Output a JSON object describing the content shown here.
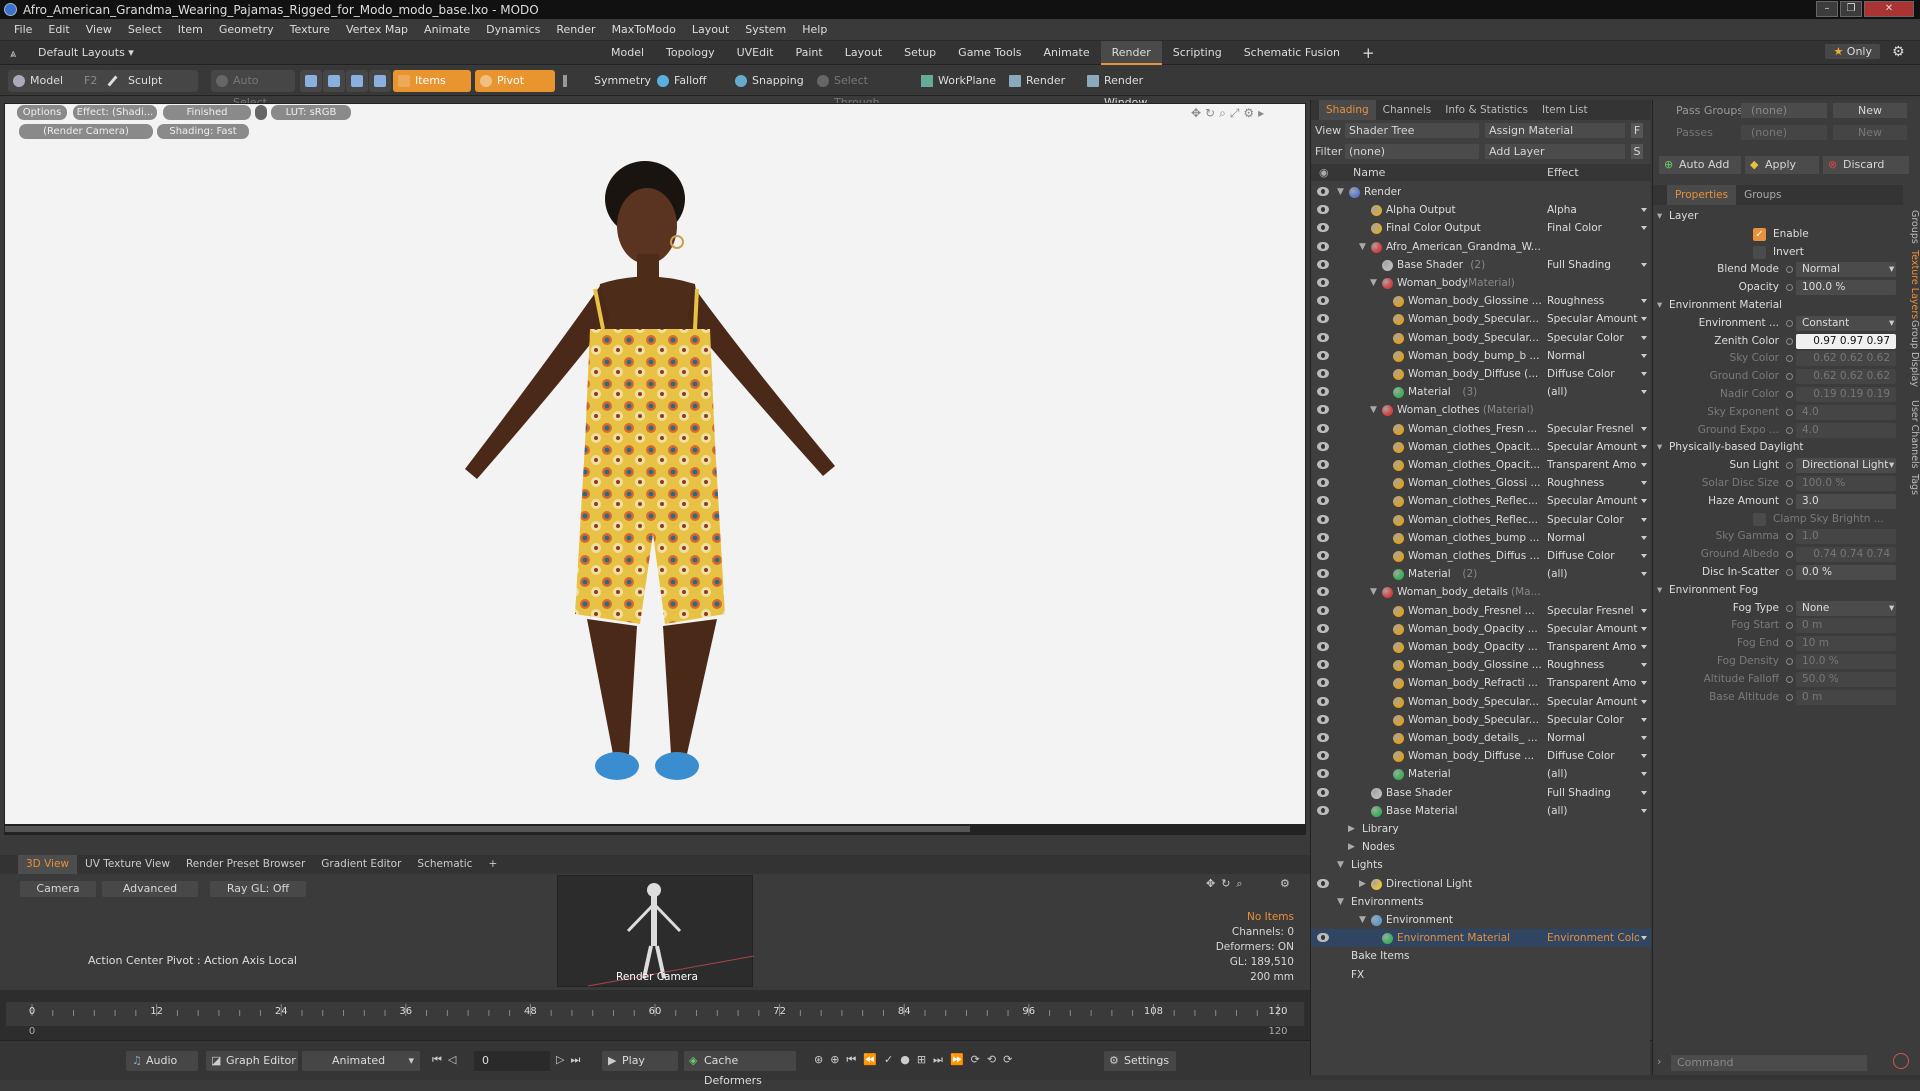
{
  "window": {
    "title": "Afro_American_Grandma_Wearing_Pajamas_Rigged_for_Modo_modo_base.lxo - MODO"
  },
  "menu": [
    "File",
    "Edit",
    "View",
    "Select",
    "Item",
    "Geometry",
    "Texture",
    "Vertex Map",
    "Animate",
    "Dynamics",
    "Render",
    "MaxToModo",
    "Layout",
    "System",
    "Help"
  ],
  "layouts": {
    "label": "Default Layouts ▾"
  },
  "tabs": [
    "Model",
    "Topology",
    "UVEdit",
    "Paint",
    "Layout",
    "Setup",
    "Game Tools",
    "Animate",
    "Render",
    "Scripting",
    "Schematic Fusion"
  ],
  "tabs_active": "Render",
  "only_label": "Only",
  "toolbar": {
    "model": "Model",
    "f2": "F2",
    "sculpt": "Sculpt",
    "auto_select": "Auto Select",
    "items": "Items",
    "pivot": "Pivot",
    "symmetry": "Symmetry",
    "falloff": "Falloff",
    "snapping": "Snapping",
    "select_through": "Select Through",
    "workplane": "WorkPlane",
    "render": "Render",
    "render_window": "Render Window"
  },
  "viewport": {
    "options": "Options",
    "effect": "Effect: (Shadi...",
    "finished": "Finished",
    "lut": "LUT: sRGB",
    "render_camera": "(Render Camera)",
    "shading": "Shading: Fast"
  },
  "bottom": {
    "tabs": [
      "3D View",
      "UV Texture View",
      "Render Preset Browser",
      "Gradient Editor",
      "Schematic"
    ],
    "active_tab": "3D View",
    "camera": "Camera",
    "advanced": "Advanced",
    "raygl": "Ray GL: Off",
    "action_center": "Action Center Pivot : Action Axis Local",
    "preview_label": "Render Camera",
    "stats": {
      "no_items": "No Items",
      "channels": "Channels: 0",
      "deformers": "Deformers: ON",
      "gl": "GL: 189,510",
      "mm": "200 mm"
    }
  },
  "timeline": {
    "ticks": [
      "0",
      "12",
      "24",
      "36",
      "48",
      "60",
      "72",
      "84",
      "96",
      "108",
      "120"
    ],
    "sub": [
      "0",
      "120"
    ]
  },
  "transport": {
    "audio": "Audio",
    "graph_editor": "Graph Editor",
    "animated": "Animated",
    "frame": "0",
    "play": "Play",
    "cache": "Cache Deformers",
    "settings": "Settings"
  },
  "shading_panel": {
    "tabs": [
      "Shading",
      "Channels",
      "Info & Statistics",
      "Item List"
    ],
    "view_label": "View",
    "view_value": "Shader Tree",
    "assign": "Assign Material",
    "f": "F",
    "filter_label": "Filter",
    "filter_value": "(none)",
    "add_layer": "Add Layer",
    "s": "S",
    "col_name": "Name",
    "col_effect": "Effect",
    "rows": [
      {
        "name": "Render",
        "effect": "",
        "indent": 0,
        "ball": "#5a7bd1",
        "expand": "▼"
      },
      {
        "name": "Alpha Output",
        "effect": "Alpha",
        "indent": 2,
        "ball": "#d6a93a"
      },
      {
        "name": "Final Color Output",
        "effect": "Final Color",
        "indent": 2,
        "ball": "#d6a93a"
      },
      {
        "name": "Afro_American_Grandma_W...",
        "effect": "",
        "indent": 2,
        "ball": "#d64040",
        "expand": "▼"
      },
      {
        "name": "Base Shader",
        "suffix": "(2)",
        "effect": "Full Shading",
        "indent": 3,
        "ball": "#bbbbbb"
      },
      {
        "name": "Woman_body",
        "suffix": "(Material)",
        "effect": "",
        "indent": 3,
        "ball": "#d64040",
        "expand": "▼"
      },
      {
        "name": "Woman_body_Glossine ...",
        "effect": "Roughness",
        "indent": 4,
        "ball": "#e0a020"
      },
      {
        "name": "Woman_body_Specular...",
        "effect": "Specular Amount",
        "indent": 4,
        "ball": "#e0a020"
      },
      {
        "name": "Woman_body_Specular...",
        "effect": "Specular Color",
        "indent": 4,
        "ball": "#e0a020"
      },
      {
        "name": "Woman_body_bump_b ...",
        "effect": "Normal",
        "indent": 4,
        "ball": "#e0a020"
      },
      {
        "name": "Woman_body_Diffuse (...",
        "effect": "Diffuse Color",
        "indent": 4,
        "ball": "#e0a020"
      },
      {
        "name": "Material",
        "suffix": "(3)",
        "effect": "(all)",
        "indent": 4,
        "ball": "#3ab05a"
      },
      {
        "name": "Woman_clothes",
        "suffix": "(Material)",
        "effect": "",
        "indent": 3,
        "ball": "#d64040",
        "expand": "▼"
      },
      {
        "name": "Woman_clothes_Fresn ...",
        "effect": "Specular Fresnel",
        "indent": 4,
        "ball": "#e0a020"
      },
      {
        "name": "Woman_clothes_Opacit...",
        "effect": "Specular Amount",
        "indent": 4,
        "ball": "#e0a020"
      },
      {
        "name": "Woman_clothes_Opacit...",
        "effect": "Transparent Amo",
        "indent": 4,
        "ball": "#e0a020"
      },
      {
        "name": "Woman_clothes_Glossi ...",
        "effect": "Roughness",
        "indent": 4,
        "ball": "#e0a020"
      },
      {
        "name": "Woman_clothes_Reflec...",
        "effect": "Specular Amount",
        "indent": 4,
        "ball": "#e0a020"
      },
      {
        "name": "Woman_clothes_Reflec...",
        "effect": "Specular Color",
        "indent": 4,
        "ball": "#e0a020"
      },
      {
        "name": "Woman_clothes_bump ...",
        "effect": "Normal",
        "indent": 4,
        "ball": "#e0a020"
      },
      {
        "name": "Woman_clothes_Diffus ...",
        "effect": "Diffuse Color",
        "indent": 4,
        "ball": "#e0a020"
      },
      {
        "name": "Material",
        "suffix": "(2)",
        "effect": "(all)",
        "indent": 4,
        "ball": "#3ab05a"
      },
      {
        "name": "Woman_body_details",
        "suffix": "(Ma...",
        "effect": "",
        "indent": 3,
        "ball": "#d64040",
        "expand": "▼"
      },
      {
        "name": "Woman_body_Fresnel ...",
        "effect": "Specular Fresnel",
        "indent": 4,
        "ball": "#e0a020"
      },
      {
        "name": "Woman_body_Opacity ...",
        "effect": "Specular Amount",
        "indent": 4,
        "ball": "#e0a020"
      },
      {
        "name": "Woman_body_Opacity ...",
        "effect": "Transparent Amo",
        "indent": 4,
        "ball": "#e0a020"
      },
      {
        "name": "Woman_body_Glossine ...",
        "effect": "Roughness",
        "indent": 4,
        "ball": "#e0a020"
      },
      {
        "name": "Woman_body_Refracti ...",
        "effect": "Transparent Amo",
        "indent": 4,
        "ball": "#e0a020"
      },
      {
        "name": "Woman_body_Specular...",
        "effect": "Specular Amount",
        "indent": 4,
        "ball": "#e0a020"
      },
      {
        "name": "Woman_body_Specular...",
        "effect": "Specular Color",
        "indent": 4,
        "ball": "#e0a020"
      },
      {
        "name": "Woman_body_details_ ...",
        "effect": "Normal",
        "indent": 4,
        "ball": "#e0a020"
      },
      {
        "name": "Woman_body_Diffuse ...",
        "effect": "Diffuse Color",
        "indent": 4,
        "ball": "#e0a020"
      },
      {
        "name": "Material",
        "effect": "(all)",
        "indent": 4,
        "ball": "#3ab05a"
      },
      {
        "name": "Base Shader",
        "effect": "Full Shading",
        "indent": 2,
        "ball": "#bbbbbb"
      },
      {
        "name": "Base Material",
        "effect": "(all)",
        "indent": 2,
        "ball": "#3ab05a"
      },
      {
        "name": "Library",
        "effect": "",
        "indent": 1,
        "noeye": true,
        "expand": "▶"
      },
      {
        "name": "Nodes",
        "effect": "",
        "indent": 1,
        "noeye": true,
        "expand": "▶"
      },
      {
        "name": "Lights",
        "effect": "",
        "indent": 0,
        "noeye": true,
        "expand": "▼"
      },
      {
        "name": "Directional Light",
        "effect": "",
        "indent": 2,
        "ball": "#e8c040",
        "expand": "▶"
      },
      {
        "name": "Environments",
        "effect": "",
        "indent": 0,
        "noeye": true,
        "expand": "▼"
      },
      {
        "name": "Environment",
        "effect": "",
        "indent": 2,
        "ball": "#5a9bd1",
        "noeye": true,
        "expand": "▼"
      },
      {
        "name": "Environment Material",
        "effect": "Environment Color",
        "indent": 3,
        "ball": "#3ab05a",
        "selected": true
      },
      {
        "name": "Bake Items",
        "effect": "",
        "indent": 0,
        "noeye": true
      },
      {
        "name": "FX",
        "effect": "",
        "indent": 0,
        "noeye": true
      }
    ]
  },
  "properties_panel": {
    "pass_groups_label": "Pass Groups",
    "pass_groups_value": "(none)",
    "new1": "New",
    "passes_label": "Passes",
    "passes_value": "(none)",
    "new2": "New",
    "auto_add": "Auto Add",
    "apply": "Apply",
    "discard": "Discard",
    "tabs": [
      "Properties",
      "Groups"
    ],
    "rows": [
      {
        "type": "hdr",
        "label": "Layer"
      },
      {
        "type": "check",
        "label": "Enable",
        "checked": true
      },
      {
        "type": "check",
        "label": "Invert",
        "checked": false
      },
      {
        "type": "field",
        "label": "Blend Mode",
        "value": "Normal",
        "dd": true
      },
      {
        "type": "field",
        "label": "Opacity",
        "value": "100.0 %"
      },
      {
        "type": "hdr",
        "label": "Environment Material"
      },
      {
        "type": "field",
        "label": "Environment ...",
        "value": "Constant",
        "dd": true
      },
      {
        "type": "field",
        "label": "Zenith Color",
        "value": "0.97   0.97   0.97",
        "bright": true
      },
      {
        "type": "field",
        "label": "Sky Color",
        "value": "0.62   0.62   0.62",
        "dim": true
      },
      {
        "type": "field",
        "label": "Ground Color",
        "value": "0.62   0.62   0.62",
        "dim": true
      },
      {
        "type": "field",
        "label": "Nadir Color",
        "value": "0.19   0.19   0.19",
        "dim": true
      },
      {
        "type": "field",
        "label": "Sky Exponent",
        "value": "4.0",
        "dim": true
      },
      {
        "type": "field",
        "label": "Ground Expo ...",
        "value": "4.0",
        "dim": true
      },
      {
        "type": "hdr",
        "label": "Physically-based Daylight"
      },
      {
        "type": "field",
        "label": "Sun Light",
        "value": "Directional Light",
        "dd": true
      },
      {
        "type": "field",
        "label": "Solar Disc Size",
        "value": "100.0 %",
        "dim": true
      },
      {
        "type": "field",
        "label": "Haze Amount",
        "value": "3.0"
      },
      {
        "type": "check",
        "label": "Clamp Sky Brightn ...",
        "checked": false,
        "dim": true
      },
      {
        "type": "field",
        "label": "Sky Gamma",
        "value": "1.0",
        "dim": true
      },
      {
        "type": "field",
        "label": "Ground Albedo",
        "value": "0.74   0.74   0.74",
        "dim": true
      },
      {
        "type": "field",
        "label": "Disc In-Scatter",
        "value": "0.0 %"
      },
      {
        "type": "hdr",
        "label": "Environment Fog"
      },
      {
        "type": "field",
        "label": "Fog Type",
        "value": "None",
        "dd": true
      },
      {
        "type": "field",
        "label": "Fog Start",
        "value": "0 m",
        "dim": true
      },
      {
        "type": "field",
        "label": "Fog End",
        "value": "10 m",
        "dim": true
      },
      {
        "type": "field",
        "label": "Fog Density",
        "value": "10.0 %",
        "dim": true
      },
      {
        "type": "field",
        "label": "Altitude Falloff",
        "value": "50.0 %",
        "dim": true
      },
      {
        "type": "field",
        "label": "Base Altitude",
        "value": "0 m",
        "dim": true
      }
    ],
    "side_tabs": [
      "Groups",
      "Texture Layers",
      "Group Display",
      "User Channels",
      "Tags"
    ],
    "command_placeholder": "Command"
  }
}
